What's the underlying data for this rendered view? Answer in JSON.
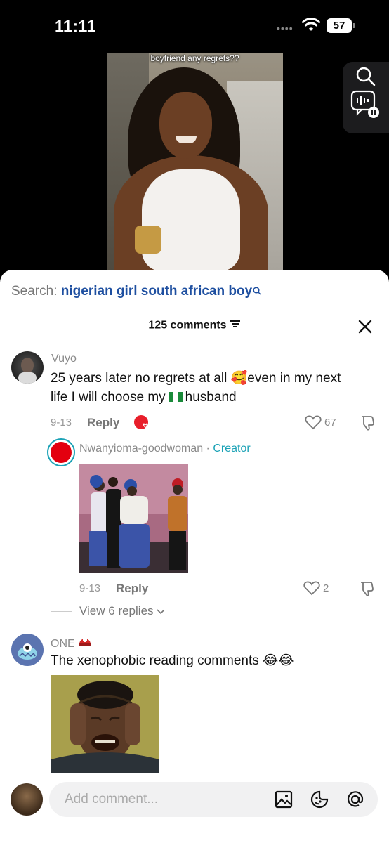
{
  "status": {
    "time": "11:11",
    "battery": "57"
  },
  "video": {
    "caption": "boyfriend any regrets??"
  },
  "sheet": {
    "search_label": "Search:",
    "search_query": "nigerian girl south african boy",
    "comments_count": "125 comments"
  },
  "comments": [
    {
      "username": "Vuyo",
      "text_part1": "25 years later no regrets at all 🥰even in my next",
      "text_part2_before": "life I will choose my",
      "text_part2_after": "husband",
      "date": "9-13",
      "reply_label": "Reply",
      "likes": "67",
      "replies": [
        {
          "username": "Nwanyioma-goodwoman",
          "badge": "Creator",
          "date": "9-13",
          "reply_label": "Reply",
          "likes": "2"
        }
      ],
      "view_replies": "View 6 replies"
    },
    {
      "username": "ONE",
      "text": "The xenophobic reading comments 😂😂"
    }
  ],
  "composer": {
    "placeholder": "Add comment..."
  },
  "colors": {
    "link": "#1e4fa0",
    "creator": "#1ba2b6",
    "nigeria_green": "#1a8a3a"
  },
  "icons": [
    "search-icon",
    "voice-search-icon",
    "sort-icon",
    "close-icon",
    "heart-icon",
    "dislike-icon",
    "image-icon",
    "emoji-icon",
    "mention-icon"
  ]
}
